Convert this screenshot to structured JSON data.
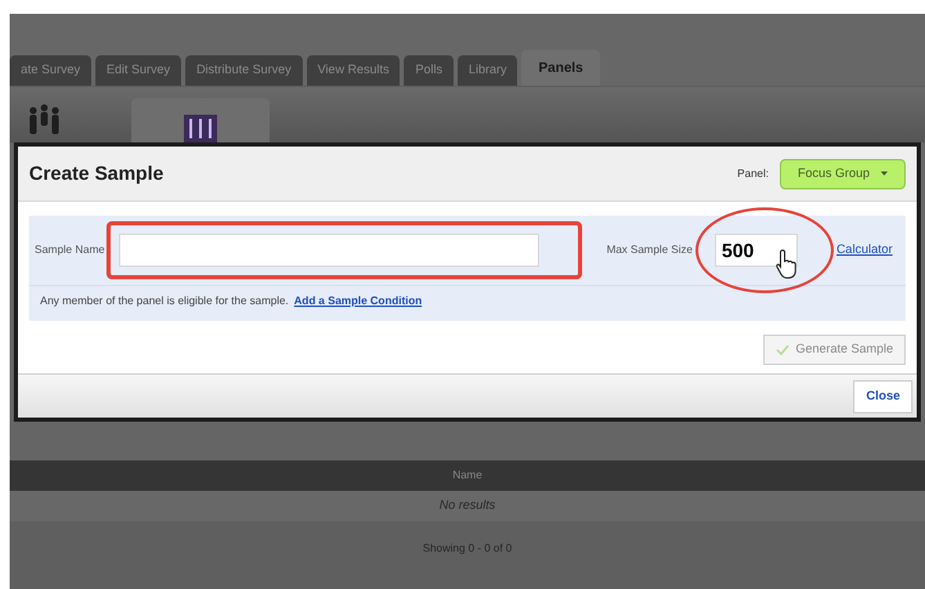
{
  "tabs": [
    {
      "label": "ate Survey",
      "selected": false
    },
    {
      "label": "Edit Survey",
      "selected": false
    },
    {
      "label": "Distribute Survey",
      "selected": false
    },
    {
      "label": "View Results",
      "selected": false
    },
    {
      "label": "Polls",
      "selected": false
    },
    {
      "label": "Library",
      "selected": false
    },
    {
      "label": "Panels",
      "selected": true
    }
  ],
  "dialog": {
    "title": "Create Sample",
    "panel_label": "Panel:",
    "panel_value": "Focus Group",
    "sample_name_label": "Sample Name",
    "max_size_label": "Max Sample Size",
    "max_size_value": "500",
    "calculator_link": "Calculator",
    "info_text": "Any member of the panel is eligible for the sample.",
    "condition_link": "Add a Sample Condition",
    "generate_button": {
      "label": "Generate Sample",
      "disabled": true
    },
    "close_button": "Close"
  },
  "table": {
    "columns": [
      "Name"
    ],
    "empty_message": "No results",
    "pager": "Showing 0 - 0 of 0"
  }
}
